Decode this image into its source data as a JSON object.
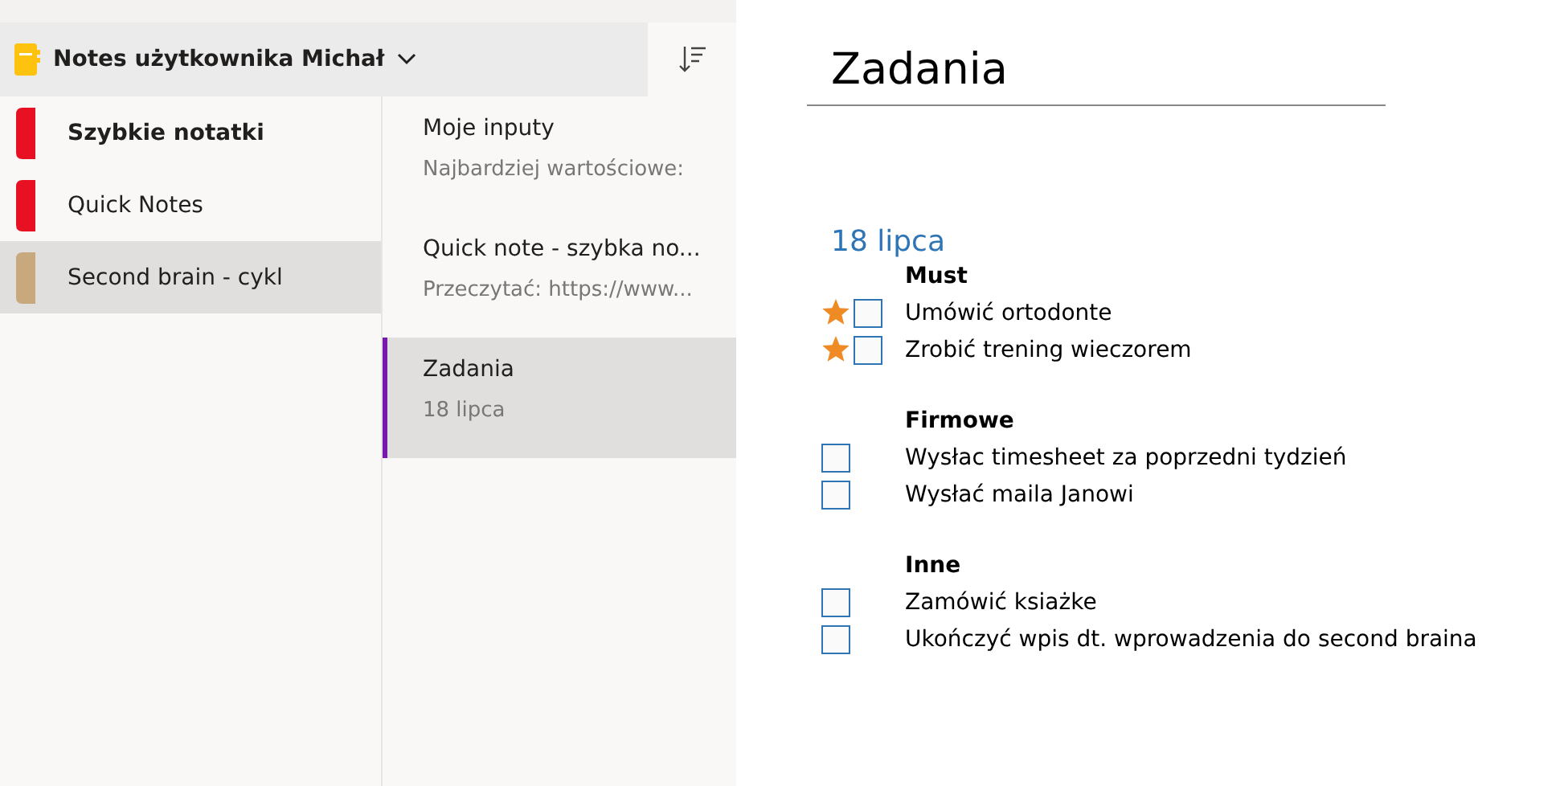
{
  "notebook": {
    "title": "Notes użytkownika Michał"
  },
  "sections": [
    {
      "label": "Szybkie notatki",
      "color": "#e81123",
      "selected": false,
      "bold": true
    },
    {
      "label": "Quick Notes",
      "color": "#e81123",
      "selected": false,
      "bold": false
    },
    {
      "label": "Second brain - cykl",
      "color": "#c8a97e",
      "selected": true,
      "bold": false
    }
  ],
  "pages": [
    {
      "title": "Moje inputy",
      "preview": "Najbardziej wartościowe:",
      "selected": false
    },
    {
      "title": "Quick note - szybka no...",
      "preview": "Przeczytać: https://www...",
      "selected": false
    },
    {
      "title": "Zadania",
      "preview": "18 lipca",
      "selected": true
    }
  ],
  "page": {
    "title": "Zadania",
    "date": "18 lipca",
    "groups": [
      {
        "heading": "Must",
        "tasks": [
          {
            "text": "Umówić ortodonte",
            "starred": true,
            "checked": false
          },
          {
            "text": "Zrobić trening wieczorem",
            "starred": true,
            "checked": false
          }
        ]
      },
      {
        "heading": "Firmowe",
        "tasks": [
          {
            "text": "Wysłac timesheet za poprzedni tydzień",
            "starred": false,
            "checked": false
          },
          {
            "text": "Wysłać maila Janowi",
            "starred": false,
            "checked": false
          }
        ]
      },
      {
        "heading": "Inne",
        "tasks": [
          {
            "text": "Zamówić ksiażke",
            "starred": false,
            "checked": false
          },
          {
            "text": "Ukończyć wpis dt. wprowadzenia do second braina",
            "starred": false,
            "checked": false
          }
        ]
      }
    ]
  }
}
